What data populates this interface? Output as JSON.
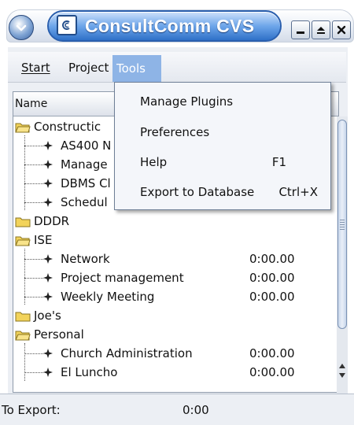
{
  "window": {
    "title": "ConsultComm CVS",
    "menu_icon": "chevron-down-icon",
    "app_icon": "app-logo-icon",
    "controls": [
      "minimize-icon",
      "maximize-icon",
      "close-icon"
    ]
  },
  "menubar": {
    "items": [
      {
        "label": "Start"
      },
      {
        "label": "Project"
      },
      {
        "label": "Tools"
      }
    ],
    "active": "Tools"
  },
  "tools_menu": {
    "items": [
      {
        "label": "Manage Plugins",
        "shortcut": ""
      },
      {
        "label": "Preferences",
        "shortcut": ""
      },
      {
        "label": "Help",
        "shortcut": "F1"
      },
      {
        "label": "Export to Database",
        "shortcut": "Ctrl+X"
      }
    ]
  },
  "table": {
    "column_name": "Name",
    "rows": [
      {
        "type": "folder",
        "label": "Constructic",
        "time": ""
      },
      {
        "type": "item",
        "label": "AS400 N",
        "time": ""
      },
      {
        "type": "item",
        "label": "Manage",
        "time": ""
      },
      {
        "type": "item",
        "label": "DBMS Cl",
        "time": ""
      },
      {
        "type": "item",
        "label": "Schedul",
        "time": ""
      },
      {
        "type": "folder",
        "label": "DDDR",
        "time": ""
      },
      {
        "type": "folder",
        "label": "ISE",
        "time": ""
      },
      {
        "type": "item",
        "label": "Network",
        "time": "0:00.00"
      },
      {
        "type": "item",
        "label": "Project management",
        "time": "0:00.00"
      },
      {
        "type": "item",
        "label": "Weekly Meeting",
        "time": "0:00.00"
      },
      {
        "type": "folder",
        "label": "Joe's",
        "time": ""
      },
      {
        "type": "folder",
        "label": "Personal",
        "time": ""
      },
      {
        "type": "item",
        "label": "Church Administration",
        "time": "0:00.00"
      },
      {
        "type": "item",
        "label": "El Luncho",
        "time": "0:00.00"
      }
    ]
  },
  "status": {
    "label": "To Export:",
    "value": "0:00"
  },
  "colors": {
    "title_blue": "#2f70c8",
    "menu_highlight": "#8eb4e6",
    "folder_yellow": "#f2d35b"
  }
}
